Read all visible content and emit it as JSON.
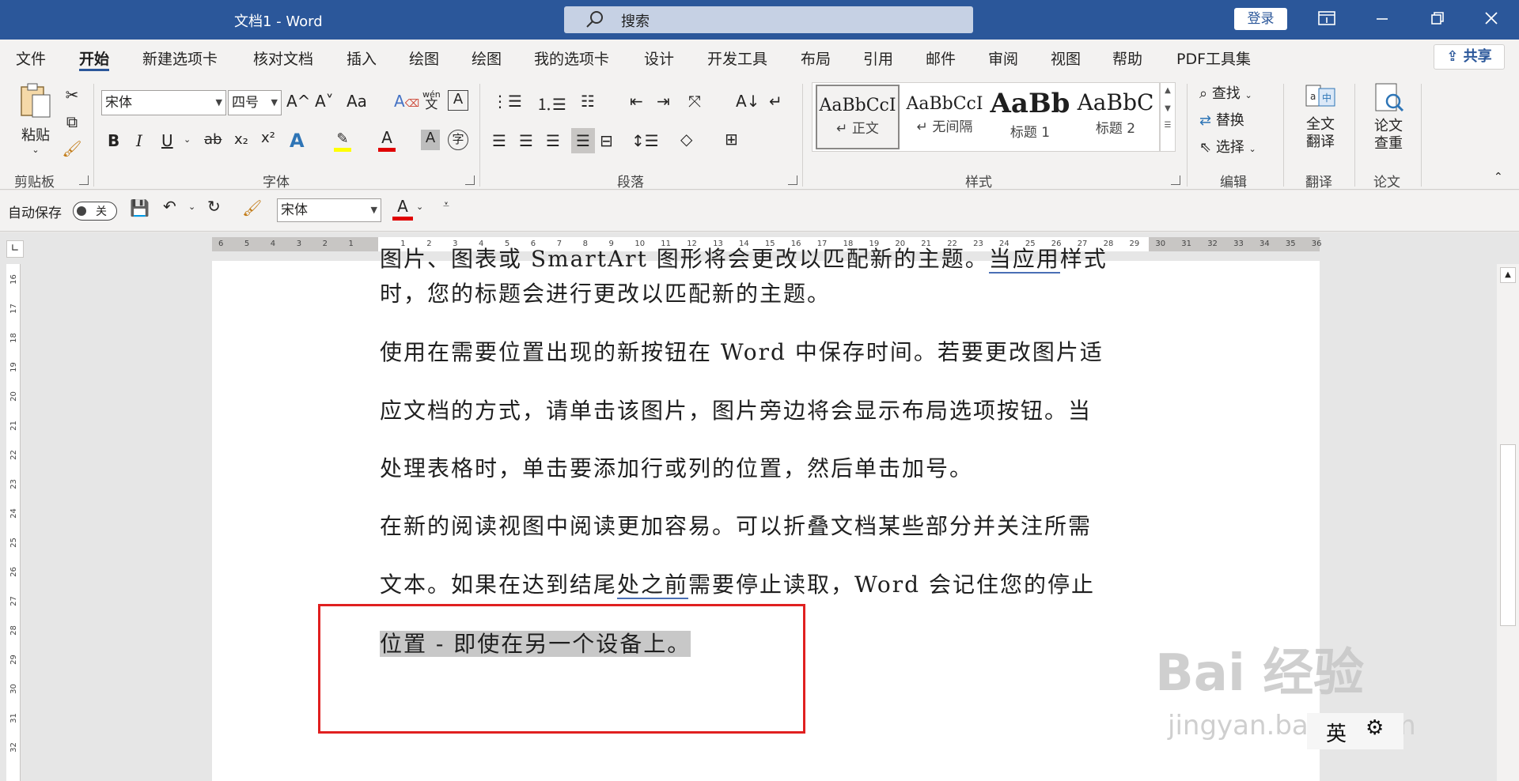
{
  "window": {
    "title": "文档1  -  Word"
  },
  "search": {
    "placeholder": "搜索"
  },
  "titlebar": {
    "login": "登录"
  },
  "tabs": [
    "文件",
    "开始",
    "新建选项卡",
    "核对文档",
    "插入",
    "绘图",
    "绘图",
    "我的选项卡",
    "设计",
    "开发工具",
    "布局",
    "引用",
    "邮件",
    "审阅",
    "视图",
    "帮助",
    "PDF工具集"
  ],
  "share": "共享",
  "ribbon": {
    "clipboard": {
      "paste": "粘贴",
      "label": "剪贴板"
    },
    "font": {
      "name": "宋体",
      "size": "四号",
      "label": "字体",
      "bold": "B",
      "italic": "I",
      "underline": "U",
      "strike": "ab",
      "subscript": "x₂",
      "superscript": "x²",
      "grow": "A^",
      "shrink": "A˅",
      "case": "Aa",
      "phonetic": "wén",
      "phonetic_char": "文"
    },
    "paragraph": {
      "label": "段落"
    },
    "styles": {
      "label": "样式",
      "items": [
        {
          "preview": "AaBbCcI",
          "name": "↵ 正文"
        },
        {
          "preview": "AaBbCcI",
          "name": "↵ 无间隔"
        },
        {
          "preview": "AaBb",
          "name": "标题 1"
        },
        {
          "preview": "AaBbC",
          "name": "标题 2"
        }
      ]
    },
    "editing": {
      "find": "查找",
      "replace": "替换",
      "select": "选择",
      "label": "编辑"
    },
    "translate": {
      "button": "全文翻译",
      "l1": "全文",
      "l2": "翻译",
      "label": "翻译"
    },
    "paper": {
      "l1": "论文",
      "l2": "查重",
      "label": "论文"
    }
  },
  "qat": {
    "autosave": "自动保存",
    "toggle": "关",
    "font": "宋体"
  },
  "ruler": {
    "h": [
      "6",
      "5",
      "4",
      "3",
      "2",
      "1",
      "",
      "1",
      "2",
      "3",
      "4",
      "5",
      "6",
      "7",
      "8",
      "9",
      "10",
      "11",
      "12",
      "13",
      "14",
      "15",
      "16",
      "17",
      "18",
      "19",
      "20",
      "21",
      "22",
      "23",
      "24",
      "25",
      "26",
      "27",
      "28",
      "29",
      "30",
      "31",
      "32",
      "33",
      "34",
      "35",
      "36"
    ],
    "v": [
      "16",
      "17",
      "18",
      "19",
      "20",
      "21",
      "22",
      "23",
      "24",
      "25",
      "26",
      "27",
      "28",
      "29",
      "30",
      "31",
      "32"
    ]
  },
  "document": {
    "l0_a": "图片、图表或 SmartArt 图形将会更改以匹配新的主题。",
    "l0_b": "当应用",
    "l0_c": "样式",
    "l1": "时，您的标题会进行更改以匹配新的主题。",
    "l2": "使用在需要位置出现的新按钮在 Word 中保存时间。若要更改图片适",
    "l3": "应文档的方式，请单击该图片，图片旁边将会显示布局选项按钮。当",
    "l4": "处理表格时，单击要添加行或列的位置，然后单击加号。",
    "l5": "在新的阅读视图中阅读更加容易。可以折叠文档某些部分并关注所需",
    "l6_a": "文本。如果在达到结尾",
    "l6_b": "处之前",
    "l6_c": "需要停止读取，Word 会记住您的停止",
    "l7": "位置 - 即使在另一个设备上。"
  },
  "ime": {
    "lang": "英"
  },
  "watermark": {
    "brand": "Bai 经验",
    "url": "jingyan.baidu.com"
  },
  "colors": {
    "accent": "#2b579a",
    "highlight_box": "#e02020"
  }
}
